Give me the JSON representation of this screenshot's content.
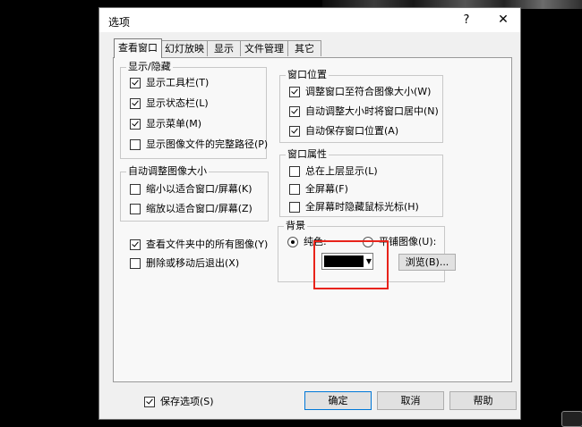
{
  "dialog": {
    "title": "选项",
    "help_label": "?",
    "close_label": "✕"
  },
  "tabs": [
    {
      "label": "查看窗口",
      "active": true
    },
    {
      "label": "幻灯放映",
      "active": false
    },
    {
      "label": "显示",
      "active": false
    },
    {
      "label": "文件管理",
      "active": false
    },
    {
      "label": "其它",
      "active": false
    }
  ],
  "show_hide": {
    "title": "显示/隐藏",
    "items": [
      {
        "label": "显示工具栏(T)",
        "checked": true
      },
      {
        "label": "显示状态栏(L)",
        "checked": true
      },
      {
        "label": "显示菜单(M)",
        "checked": true
      },
      {
        "label": "显示图像文件的完整路径(P)",
        "checked": false
      }
    ]
  },
  "window_position": {
    "title": "窗口位置",
    "items": [
      {
        "label": "调整窗口至符合图像大小(W)",
        "checked": true
      },
      {
        "label": "自动调整大小时将窗口居中(N)",
        "checked": true
      },
      {
        "label": "自动保存窗口位置(A)",
        "checked": true
      }
    ]
  },
  "auto_resize": {
    "title": "自动调整图像大小",
    "items": [
      {
        "label": "缩小以适合窗口/屏幕(K)",
        "checked": false
      },
      {
        "label": "缩放以适合窗口/屏幕(Z)",
        "checked": false
      }
    ]
  },
  "window_props": {
    "title": "窗口属性",
    "items": [
      {
        "label": "总在上层显示(L)",
        "checked": false
      },
      {
        "label": "全屏幕(F)",
        "checked": false
      },
      {
        "label": "全屏幕时隐藏鼠标光标(H)",
        "checked": false
      }
    ]
  },
  "misc": [
    {
      "label": "查看文件夹中的所有图像(Y)",
      "checked": true
    },
    {
      "label": "删除或移动后退出(X)",
      "checked": false
    }
  ],
  "background": {
    "title": "背景",
    "solid_label": "纯色:",
    "tile_label": "平铺图像(U):",
    "solid_selected": true,
    "color": "#000000",
    "browse_label": "浏览(B)..."
  },
  "footer": {
    "save_options_label": "保存选项(S)",
    "save_options_checked": true,
    "ok_label": "确定",
    "cancel_label": "取消",
    "help_label": "帮助"
  },
  "colors": {
    "highlight": "#e8231a",
    "default_button_border": "#0078d7"
  }
}
